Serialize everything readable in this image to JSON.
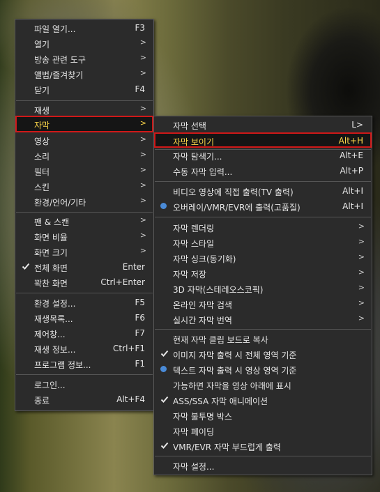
{
  "main_menu": {
    "items": [
      {
        "label": "파일 열기...",
        "shortcut": "F3"
      },
      {
        "label": "열기",
        "arrow": ">"
      },
      {
        "label": "방송 관련 도구",
        "arrow": ">"
      },
      {
        "label": "앨범/즐겨찾기",
        "arrow": ">"
      },
      {
        "label": "닫기",
        "shortcut": "F4"
      },
      {
        "label": "재생",
        "arrow": ">"
      },
      {
        "label": "자막",
        "arrow": ">"
      },
      {
        "label": "영상",
        "arrow": ">"
      },
      {
        "label": "소리",
        "arrow": ">"
      },
      {
        "label": "필터",
        "arrow": ">"
      },
      {
        "label": "스킨",
        "arrow": ">"
      },
      {
        "label": "환경/언어/기타",
        "arrow": ">"
      },
      {
        "label": "팬 & 스캔",
        "arrow": ">"
      },
      {
        "label": "화면 비율",
        "arrow": ">"
      },
      {
        "label": "화면 크기",
        "arrow": ">"
      },
      {
        "label": "전체 화면",
        "shortcut": "Enter"
      },
      {
        "label": "꽉찬 화면",
        "shortcut": "Ctrl+Enter"
      },
      {
        "label": "환경 설정...",
        "shortcut": "F5"
      },
      {
        "label": "재생목록...",
        "shortcut": "F6"
      },
      {
        "label": "제어창...",
        "shortcut": "F7"
      },
      {
        "label": "재생 정보...",
        "shortcut": "Ctrl+F1"
      },
      {
        "label": "프로그램 정보...",
        "shortcut": "F1"
      },
      {
        "label": "로그인..."
      },
      {
        "label": "종료",
        "shortcut": "Alt+F4"
      }
    ]
  },
  "subtitle_menu": {
    "items": [
      {
        "label": "자막 선택",
        "shortcut": "L>"
      },
      {
        "label": "자막 보이기",
        "shortcut": "Alt+H"
      },
      {
        "label": "자막 탐색기...",
        "shortcut": "Alt+E"
      },
      {
        "label": "수동 자막 입력...",
        "shortcut": "Alt+P"
      },
      {
        "label": "비디오 영상에 직접 출력(TV 출력)",
        "shortcut": "Alt+I"
      },
      {
        "label": "오버레이/VMR/EVR에 출력(고품질)",
        "shortcut": "Alt+I"
      },
      {
        "label": "자막 렌더링",
        "arrow": ">"
      },
      {
        "label": "자막 스타일",
        "arrow": ">"
      },
      {
        "label": "자막 싱크(동기화)",
        "arrow": ">"
      },
      {
        "label": "자막 저장",
        "arrow": ">"
      },
      {
        "label": "3D 자막(스테레오스코픽)",
        "arrow": ">"
      },
      {
        "label": "온라인 자막 검색",
        "arrow": ">"
      },
      {
        "label": "실시간 자막 번역",
        "arrow": ">"
      },
      {
        "label": "현재 자막 클립 보드로 복사"
      },
      {
        "label": "이미지 자막 출력 시 전체 영역 기준"
      },
      {
        "label": "텍스트 자막 출력 시 영상 영역 기준"
      },
      {
        "label": "가능하면 자막을 영상 아래에 표시"
      },
      {
        "label": "ASS/SSA 자막 애니메이션"
      },
      {
        "label": "자막 불투명 박스"
      },
      {
        "label": "자막 페이딩"
      },
      {
        "label": "VMR/EVR 자막 부드럽게 출력"
      },
      {
        "label": "자막 설정..."
      }
    ]
  },
  "colors": {
    "highlight_border": "#d01818",
    "highlight_text": "#ffd84a",
    "radio": "#4a8bd8"
  }
}
